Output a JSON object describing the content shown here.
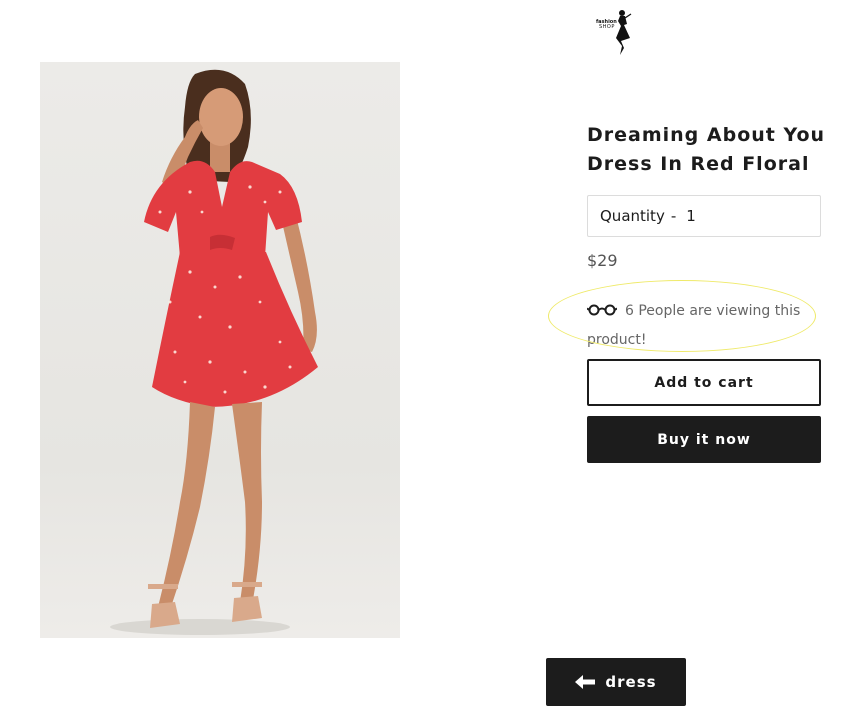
{
  "logo": {
    "line1": "fashion",
    "line2": "SHOP",
    "icon": "dress-silhouette-logo-icon"
  },
  "product": {
    "image_alt": "woman-in-red-floral-dress",
    "title": "Dreaming About You Dress In Red Floral",
    "quantity_label": "Quantity",
    "quantity_separator": "-",
    "quantity_value": "1",
    "price": "$29",
    "viewers_text": "6 People are viewing this product!",
    "viewers_icon": "glasses-icon",
    "add_to_cart_label": "Add to cart",
    "buy_now_label": "Buy it now"
  },
  "back_button": {
    "label": "dress",
    "icon": "arrow-left-icon"
  },
  "colors": {
    "button_dark": "#1c1c1c",
    "highlight": "#efea6a",
    "dress_red": "#e23c41"
  }
}
